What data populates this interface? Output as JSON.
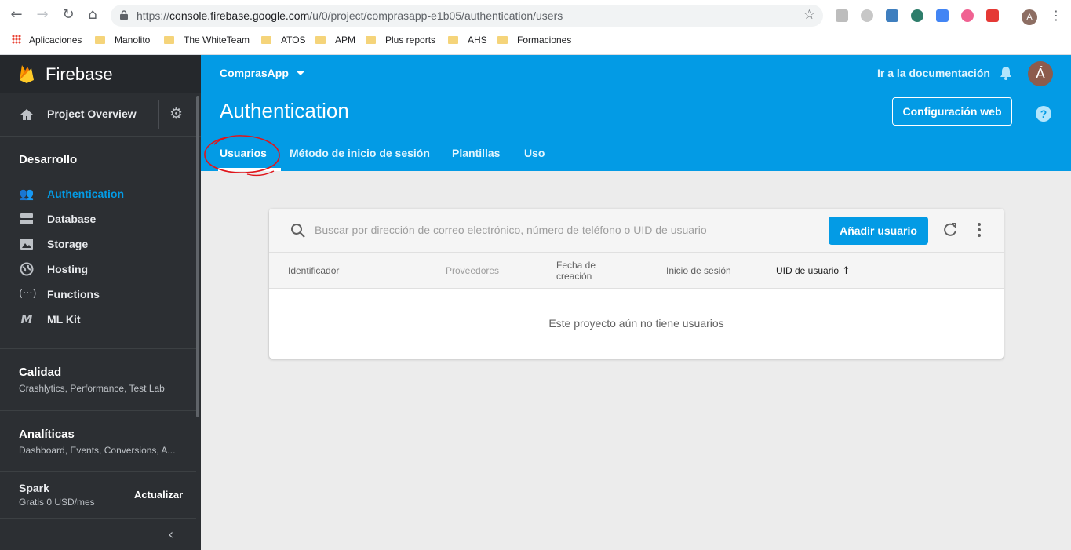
{
  "browser": {
    "url_prefix": "https://",
    "url_host": "console.firebase.google.com",
    "url_path": "/u/0/project/comprasapp-e1b05/authentication/users",
    "avatar_letter": "A",
    "bookmarks": [
      "Aplicaciones",
      "Manolito",
      "The WhiteTeam",
      "ATOS",
      "APM",
      "Plus reports",
      "AHS",
      "Formaciones"
    ]
  },
  "sidebar": {
    "brand": "Firebase",
    "overview": "Project Overview",
    "dev_section": "Desarrollo",
    "items": [
      {
        "label": "Authentication",
        "icon": "people-icon"
      },
      {
        "label": "Database",
        "icon": "database-icon"
      },
      {
        "label": "Storage",
        "icon": "storage-icon"
      },
      {
        "label": "Hosting",
        "icon": "globe-icon"
      },
      {
        "label": "Functions",
        "icon": "functions-icon"
      },
      {
        "label": "ML Kit",
        "icon": "ml-kit-icon"
      }
    ],
    "quality_title": "Calidad",
    "quality_sub": "Crashlytics, Performance, Test Lab",
    "analytics_title": "Analíticas",
    "analytics_sub": "Dashboard, Events, Conversions, A...",
    "plan_name": "Spark",
    "plan_price": "Gratis 0 USD/mes",
    "upgrade": "Actualizar"
  },
  "header": {
    "project": "ComprasApp",
    "docs_link": "Ir a la documentación",
    "avatar_letter": "Á",
    "title": "Authentication",
    "web_config": "Configuración web",
    "help": "?",
    "tabs": [
      "Usuarios",
      "Método de inicio de sesión",
      "Plantillas",
      "Uso"
    ]
  },
  "users": {
    "search_placeholder": "Buscar por dirección de correo electrónico, número de teléfono o UID de usuario",
    "add_button": "Añadir usuario",
    "columns": [
      "Identificador",
      "Proveedores",
      "Fecha de creación",
      "Inicio de sesión",
      "UID de usuario"
    ],
    "sort_indicator": "↑",
    "empty_message": "Este proyecto aún no tiene usuarios"
  },
  "colors": {
    "accent": "#039be5",
    "sidebar_bg": "#2c2f33",
    "annotation": "#e0151b"
  }
}
